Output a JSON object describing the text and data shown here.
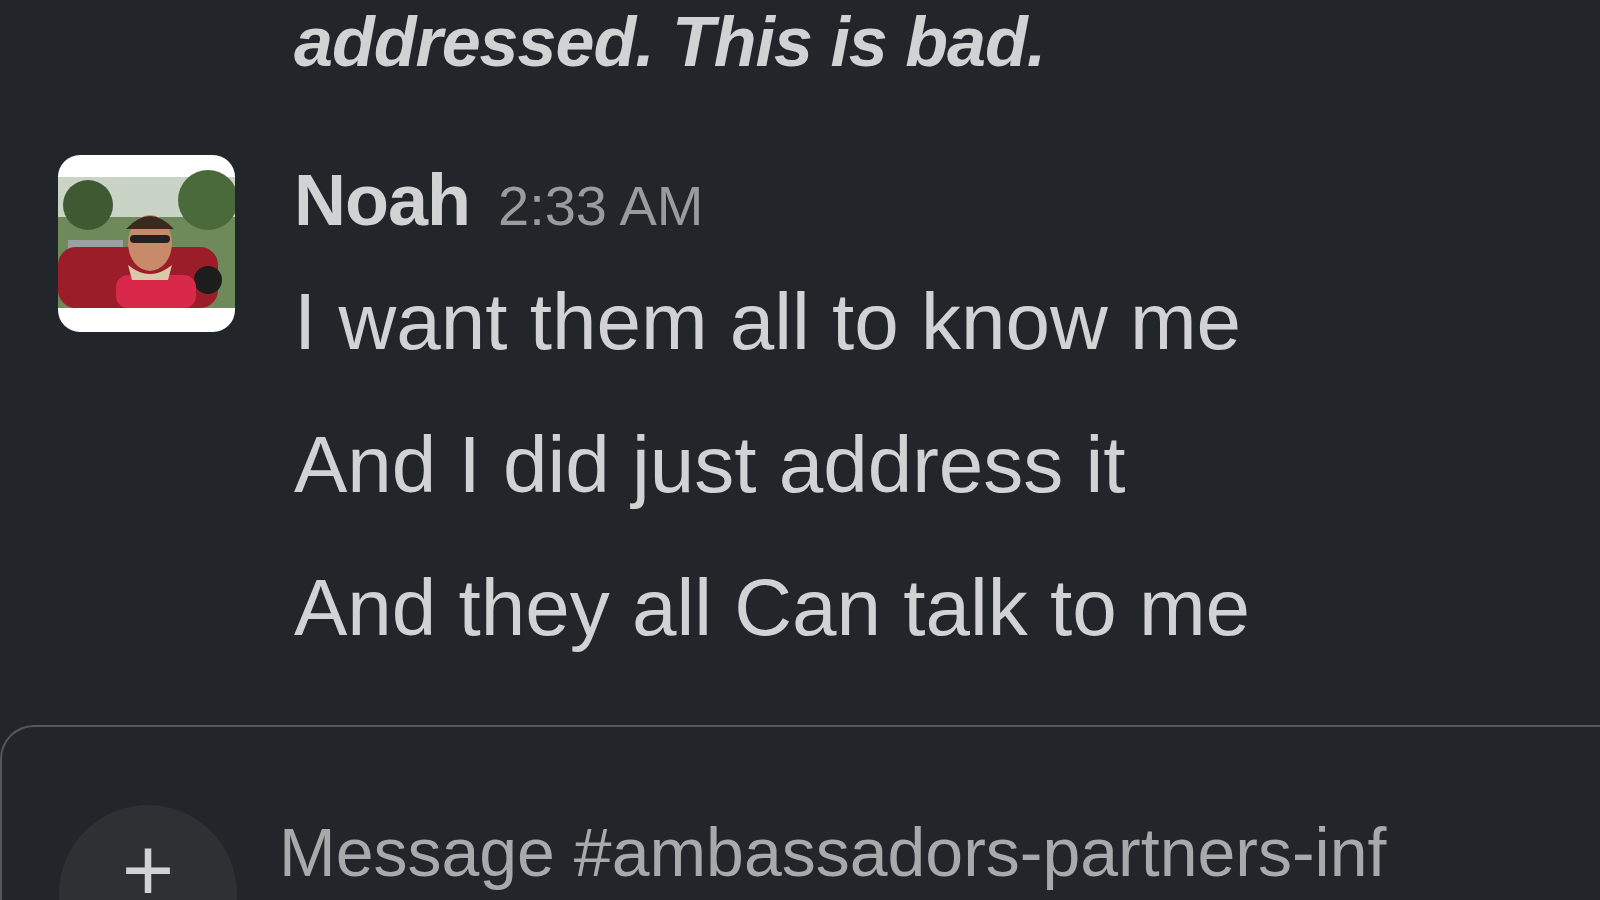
{
  "previous_message": {
    "text": "addressed. This is bad."
  },
  "message": {
    "author": "Noah",
    "time": "2:33 AM",
    "lines": [
      "I want them all to know me",
      "And I did just address it",
      "And they all Can talk to me"
    ]
  },
  "composer": {
    "add_button": "+",
    "placeholder": "Message #ambassadors-partners-inf"
  }
}
